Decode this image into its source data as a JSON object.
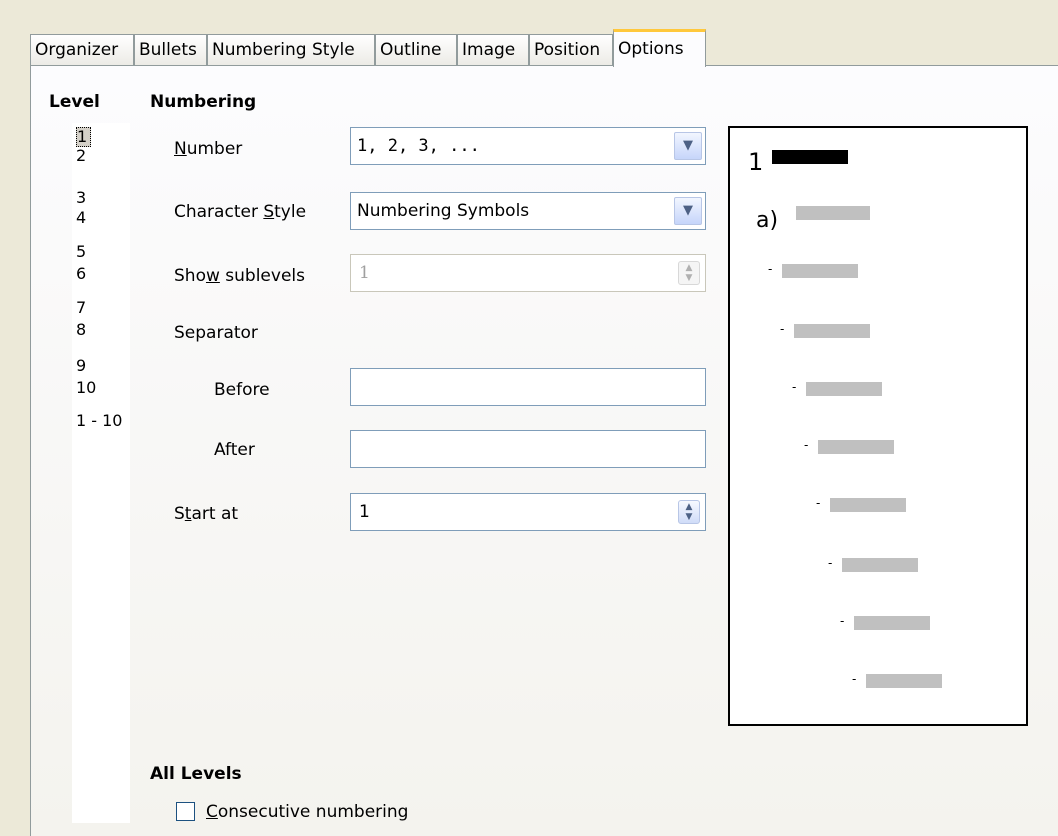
{
  "tabs": [
    "Organizer",
    "Bullets",
    "Numbering Style",
    "Outline",
    "Image",
    "Position",
    "Options"
  ],
  "active_tab": "Options",
  "level": {
    "heading": "Level",
    "items": [
      "1",
      "2",
      "3",
      "4",
      "5",
      "6",
      "7",
      "8",
      "9",
      "10",
      "1 - 10"
    ],
    "selected": "1"
  },
  "numbering": {
    "heading": "Numbering",
    "number_label": "Number",
    "number_value": "1, 2, 3, ...",
    "char_style_label": "Character Style",
    "char_style_value": "Numbering Symbols",
    "show_sublevels_label": "Show sublevels",
    "show_sublevels_value": "1",
    "separator_label": "Separator",
    "before_label": "Before",
    "before_value": "",
    "after_label": "After",
    "after_value": "",
    "start_at_label": "Start at",
    "start_at_value": "1"
  },
  "preview": {
    "first_label": "1",
    "second_label": "a)",
    "dash": "-"
  },
  "all_levels": {
    "heading": "All Levels",
    "consecutive_label": "Consecutive numbering",
    "consecutive_checked": false
  }
}
